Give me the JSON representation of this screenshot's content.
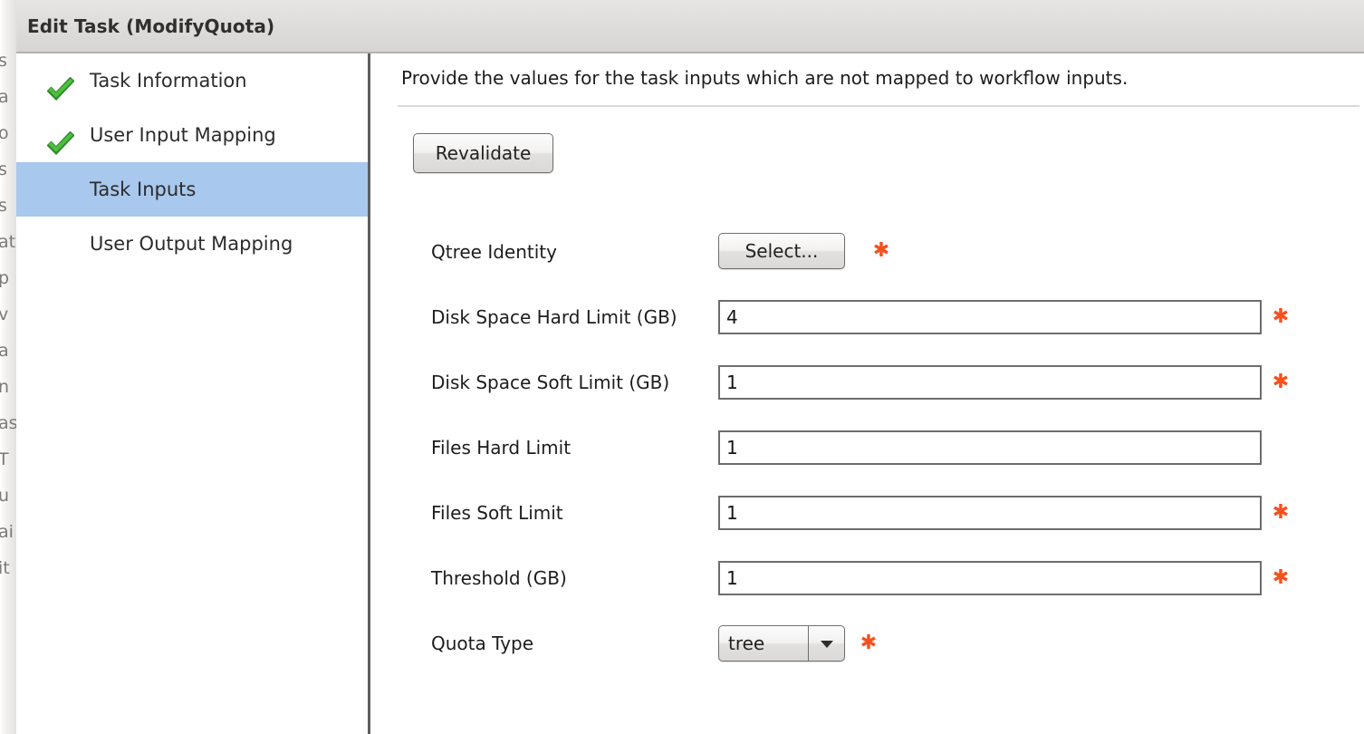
{
  "window": {
    "title": "Edit Task (ModifyQuota)"
  },
  "backdrop": {
    "clipped_lines": [
      "s",
      "a",
      "o",
      "s",
      "s",
      "at",
      "p",
      "v",
      "a",
      "n",
      "as",
      "T",
      "u",
      "ai",
      "it"
    ]
  },
  "sidebar": {
    "items": [
      {
        "label": "Task Information",
        "icon": "green-check-icon",
        "completed": true,
        "selected": false
      },
      {
        "label": "User Input Mapping",
        "icon": "green-check-icon",
        "completed": true,
        "selected": false
      },
      {
        "label": "Task Inputs",
        "icon": "",
        "completed": false,
        "selected": true
      },
      {
        "label": "User Output Mapping",
        "icon": "",
        "completed": false,
        "selected": false
      }
    ]
  },
  "content": {
    "instruction": "Provide the values for the task inputs which are not mapped to workflow inputs.",
    "revalidate_label": "Revalidate",
    "required_marker": "✱",
    "fields": [
      {
        "label": "Qtree Identity",
        "control": "button",
        "button_label": "Select...",
        "value": "",
        "required": true
      },
      {
        "label": "Disk Space Hard Limit (GB)",
        "control": "text",
        "value": "4",
        "placeholder": "",
        "required": true
      },
      {
        "label": "Disk Space Soft Limit (GB)",
        "control": "text",
        "value": "1",
        "placeholder": "",
        "required": true
      },
      {
        "label": "Files Hard Limit",
        "control": "text",
        "value": "1",
        "placeholder": "",
        "required": false
      },
      {
        "label": "Files Soft Limit",
        "control": "text",
        "value": "1",
        "placeholder": "",
        "required": true
      },
      {
        "label": "Threshold (GB)",
        "control": "text",
        "value": "1",
        "placeholder": "",
        "required": true
      },
      {
        "label": "Quota Type",
        "control": "select",
        "value": "tree",
        "options": [
          "tree"
        ],
        "required": true
      }
    ]
  },
  "colors": {
    "selected_nav": "#a8c8ee",
    "required_asterisk": "#f4511e",
    "check_green": "#3faf3a",
    "titlebar": "#dedcdb",
    "field_border": "#6d6d6d"
  }
}
